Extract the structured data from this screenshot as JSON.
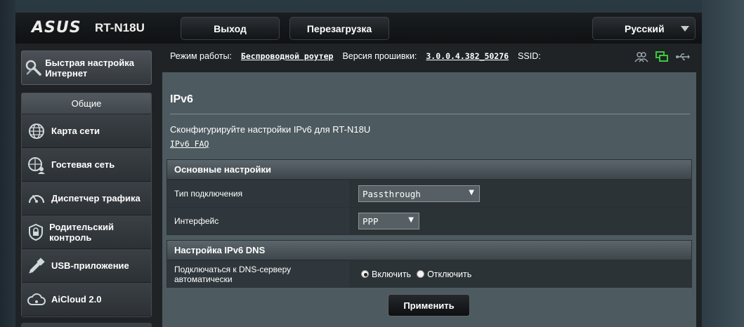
{
  "header": {
    "brand": "ASUS",
    "model": "RT-N18U",
    "logout_label": "Выход",
    "reboot_label": "Перезагрузка",
    "language": "Русский"
  },
  "sidebar": {
    "quick_setup": "Быстрая настройка Интернет",
    "section_title": "Общие",
    "items": [
      {
        "label": "Карта сети",
        "icon": "globe-network-icon"
      },
      {
        "label": "Гостевая сеть",
        "icon": "guest-network-icon"
      },
      {
        "label": "Диспетчер трафика",
        "icon": "speedometer-icon"
      },
      {
        "label": "Родительский контроль",
        "icon": "parental-lock-icon"
      },
      {
        "label": "USB-приложение",
        "icon": "usb-icon"
      },
      {
        "label": "AiCloud 2.0",
        "icon": "cloud-icon"
      }
    ]
  },
  "status": {
    "mode_label": "Режим работы:",
    "mode_value": "Беспроводной роутер",
    "firmware_label": "Версия прошивки:",
    "firmware_value": "3.0.0.4.382_50276",
    "ssid_label": "SSID:"
  },
  "page": {
    "title": "IPv6",
    "description": "Сконфигурируйте настройки IPv6 для RT-N18U",
    "faq_link": "IPv6 FAQ"
  },
  "basic": {
    "header": "Основные настройки",
    "connection_type_label": "Тип подключения",
    "connection_type_value": "Passthrough",
    "interface_label": "Интерфейс",
    "interface_value": "PPP"
  },
  "dns": {
    "header": "Настройка IPv6 DNS",
    "auto_label": "Подключаться к DNS-серверу автоматически",
    "enable_label": "Включить",
    "disable_label": "Отключить",
    "selected": "enable"
  },
  "apply_label": "Применить",
  "colors": {
    "panel": "#4d5a60",
    "section_header": "#4a545a",
    "status_green": "#3cc83c"
  }
}
